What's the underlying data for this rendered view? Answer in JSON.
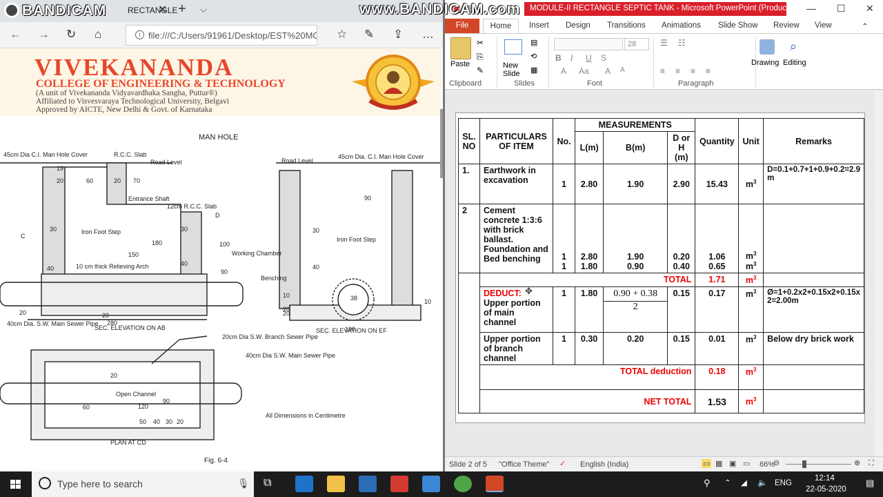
{
  "browser": {
    "bandicam_logo": "BANDICAM",
    "tab_title": "RECTANGLE",
    "tab_close": "✕",
    "new_tab": "+",
    "address": "file:///C:/Users/91961/Desktop/EST%20MOD",
    "college": {
      "name": "VIVEKANANDA",
      "subtitle": "COLLEGE OF ENGINEERING & TECHNOLOGY",
      "line1": "(A unit of Vivekananda Vidyavardhaka Sangha, Puttur®)",
      "line2": "Affiliated to Visvesvaraya Technological University, Belgavi",
      "line3": "Approved by AICTE, New Delhi & Govt. of Karnataka"
    },
    "figure": {
      "title": "MAN HOLE",
      "cover_label": "45cm Dia C.I. Man Hole Cover",
      "rcc_slab": "R.C.C. Slab",
      "road_level": "Road Level",
      "road_level_2": "Road Level",
      "cover_label_2": "45cm Dia. C.I. Man Hole Cover",
      "entrance_shaft": "Entrance Shaft",
      "rcc_12": "12cm R.C.C. Slab",
      "iron_step": "Iron Foot Step",
      "iron_step_2": "Iron Foot Step",
      "working_chamber": "Working Chamber",
      "relieving_arch": "10 cm thick Relieving Arch",
      "benching": "Benching",
      "main_sewer": "40cm Dia. S.W. Main Sewer Pipe",
      "sec_ab": "SEC. ELEVATION ON AB",
      "sec_ef": "SEC. ELEVATION ON EF",
      "branch_pipe": "20cm Dia S.W. Branch Sewer Pipe",
      "main_pipe_2": "40cm Dia S.W. Main Sewer Pipe",
      "open_channel": "Open Channel",
      "all_dims": "All Dimensions in Centimetre",
      "plan": "PLAN AT CD",
      "fig_no": "Fig. 6-4",
      "dims": [
        "19",
        "20",
        "60",
        "20",
        "70",
        "180",
        "150",
        "100",
        "90",
        "40",
        "30",
        "30",
        "40",
        "280",
        "20",
        "20",
        "10",
        "20",
        "90",
        "190",
        "38",
        "40",
        "10",
        "20",
        "30",
        "120",
        "90",
        "60",
        "20",
        "50",
        "40",
        "30",
        "20",
        "C",
        "D"
      ]
    }
  },
  "ppt": {
    "bandicam_url": "www.BANDICAM.com",
    "window_title": "MODULE-II  RECTANGLE SEPTIC TANK  -  Microsoft PowerPoint (Product...",
    "ribbon_tabs": [
      "File",
      "Home",
      "Insert",
      "Design",
      "Transitions",
      "Animations",
      "Slide Show",
      "Review",
      "View"
    ],
    "groups": {
      "clipboard": "Clipboard",
      "slides": "Slides",
      "font": "Font",
      "paragraph": "Paragraph"
    },
    "buttons": {
      "paste": "Paste",
      "new_slide": "New Slide",
      "drawing": "Drawing",
      "editing": "Editing"
    },
    "font_size": "28",
    "status": {
      "slide": "Slide 2 of 5",
      "theme": "\"Office Theme\"",
      "language": "English (India)",
      "zoom": "66%"
    }
  },
  "table": {
    "headers": {
      "sl": "SL. NO",
      "particulars": "PARTICULARS OF ITEM",
      "no": "No.",
      "measurements": "MEASUREMENTS",
      "l": "L(m)",
      "b": "B(m)",
      "d": "D or H (m)",
      "quantity": "Quantity",
      "unit": "Unit",
      "remarks": "Remarks"
    },
    "row1": {
      "sl": "1.",
      "item": "Earthwork in excavation",
      "no": "1",
      "l": "2.80",
      "b": "1.90",
      "d": "2.90",
      "qty": "15.43",
      "unit": "m",
      "remarks": "D=0.1+0.7+1+0.9+0.2=2.9 m"
    },
    "row2": {
      "sl": "2",
      "item1": "Cement concrete 1:3:6 with brick ballast.",
      "item2": "Foundation and",
      "item3": "Bed benching",
      "no1": "1",
      "no2": "1",
      "l1": "2.80",
      "l2": "1.80",
      "b1": "1.90",
      "b2": "0.90",
      "d1": "0.20",
      "d2": "0.40",
      "q1": "1.06",
      "q2": "0.65",
      "u1": "m",
      "u2": "m"
    },
    "total": {
      "label": "TOTAL",
      "qty": "1.71",
      "unit": "m"
    },
    "deduct": {
      "label": "DEDUCT:",
      "item": "Upper portion of main channel",
      "no": "1",
      "l": "1.80",
      "b_num": "0.90 + 0.38",
      "b_den": "2",
      "d": "0.15",
      "qty": "0.17",
      "unit": "m",
      "remarks": "Ø=1+0.2x2+0.15x2+0.15x2=2.00m"
    },
    "branch": {
      "item": "Upper portion of branch channel",
      "no": "1",
      "l": "0.30",
      "b": "0.20",
      "d": "0.15",
      "qty": "0.01",
      "unit": "m",
      "remarks": "Below dry brick work"
    },
    "total_deduction": {
      "label": "TOTAL  deduction",
      "qty": "0.18",
      "unit": "m"
    },
    "net_total": {
      "label": "NET TOTAL",
      "qty": "1.53",
      "unit": "m"
    },
    "unit_exp": "3"
  },
  "taskbar": {
    "search_placeholder": "Type here to search",
    "time": "12:14",
    "date": "22-05-2020",
    "lang": "ENG"
  }
}
